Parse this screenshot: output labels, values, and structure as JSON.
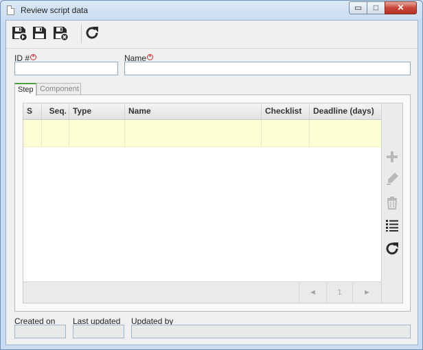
{
  "window": {
    "title": "Review script data",
    "minimize_glyph": "▭",
    "maximize_glyph": "□",
    "close_glyph": "✕"
  },
  "toolbar": {
    "buttons": [
      {
        "icon": "save-new-icon"
      },
      {
        "icon": "save-icon"
      },
      {
        "icon": "save-close-icon"
      },
      {
        "icon": "refresh-icon"
      }
    ]
  },
  "form": {
    "id_label": "ID #",
    "id_value": "",
    "name_label": "Name",
    "name_value": "",
    "required_glyph": "*"
  },
  "tabs": [
    {
      "label": "Step",
      "active": true
    },
    {
      "label": "Component",
      "active": false
    }
  ],
  "grid": {
    "columns": [
      "S",
      "Seq.",
      "Type",
      "Name",
      "Checklist",
      "Deadline (days)"
    ],
    "rows": [
      [
        "",
        "",
        "",
        "",
        "",
        ""
      ]
    ],
    "side_tools": [
      {
        "icon": "add-icon",
        "enabled": false
      },
      {
        "icon": "edit-icon",
        "enabled": false
      },
      {
        "icon": "delete-icon",
        "enabled": false
      },
      {
        "icon": "list-icon",
        "enabled": true
      },
      {
        "icon": "refresh-icon",
        "enabled": true
      }
    ],
    "pager": {
      "prev_glyph": "◄",
      "page": "1",
      "next_glyph": "►"
    }
  },
  "footer": {
    "created_label": "Created on",
    "created_value": "",
    "updated_label": "Last updated",
    "updated_value": "",
    "updated_by_label": "Updated by",
    "updated_by_value": ""
  },
  "colors": {
    "row_highlight": "#fcfed4",
    "active_tab_accent": "#4aa03f",
    "required_marker": "#d12b2b"
  }
}
